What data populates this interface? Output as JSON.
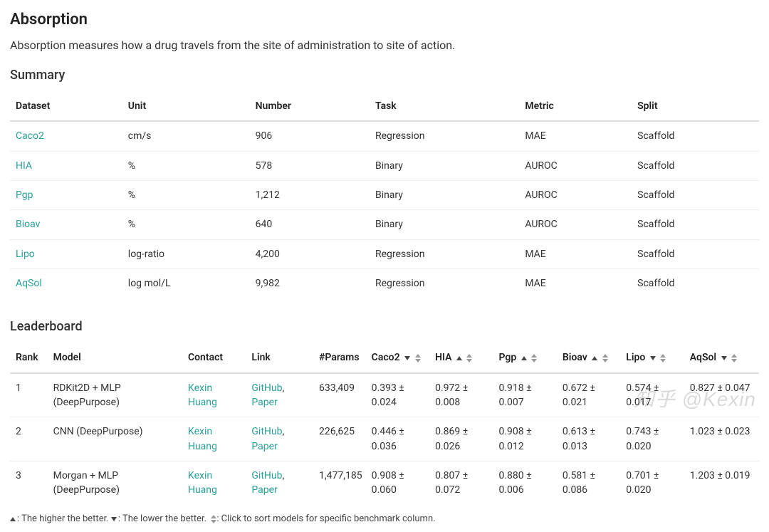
{
  "title": "Absorption",
  "lead": "Absorption measures how a drug travels from the site of administration to site of action.",
  "summary": {
    "heading": "Summary",
    "columns": [
      "Dataset",
      "Unit",
      "Number",
      "Task",
      "Metric",
      "Split"
    ],
    "rows": [
      {
        "dataset": "Caco2",
        "unit": "cm/s",
        "number": "906",
        "task": "Regression",
        "metric": "MAE",
        "split": "Scaffold"
      },
      {
        "dataset": "HIA",
        "unit": "%",
        "number": "578",
        "task": "Binary",
        "metric": "AUROC",
        "split": "Scaffold"
      },
      {
        "dataset": "Pgp",
        "unit": "%",
        "number": "1,212",
        "task": "Binary",
        "metric": "AUROC",
        "split": "Scaffold"
      },
      {
        "dataset": "Bioav",
        "unit": "%",
        "number": "640",
        "task": "Binary",
        "metric": "AUROC",
        "split": "Scaffold"
      },
      {
        "dataset": "Lipo",
        "unit": "log-ratio",
        "number": "4,200",
        "task": "Regression",
        "metric": "MAE",
        "split": "Scaffold"
      },
      {
        "dataset": "AqSol",
        "unit": "log mol/L",
        "number": "9,982",
        "task": "Regression",
        "metric": "MAE",
        "split": "Scaffold"
      }
    ]
  },
  "leaderboard": {
    "heading": "Leaderboard",
    "columns": {
      "rank": "Rank",
      "model": "Model",
      "contact": "Contact",
      "link": "Link",
      "params": "#Params",
      "caco2": "Caco2",
      "hia": "HIA",
      "pgp": "Pgp",
      "bioav": "Bioav",
      "lipo": "Lipo",
      "aqsol": "AqSol"
    },
    "column_dir": {
      "caco2": "down",
      "hia": "up",
      "pgp": "up",
      "bioav": "up",
      "lipo": "down",
      "aqsol": "down"
    },
    "rows": [
      {
        "rank": "1",
        "model": "RDKit2D + MLP (DeepPurpose)",
        "contact": "Kexin Huang",
        "link1": "GitHub",
        "link2": "Paper",
        "link_sep": ", ",
        "params": "633,409",
        "caco2": "0.393 ± 0.024",
        "hia": "0.972 ± 0.008",
        "pgp": "0.918 ± 0.007",
        "bioav": "0.672 ± 0.021",
        "lipo": "0.574 ± 0.017",
        "aqsol": "0.827 ± 0.047"
      },
      {
        "rank": "2",
        "model": "CNN (DeepPurpose)",
        "contact": "Kexin Huang",
        "link1": "GitHub",
        "link2": "Paper",
        "link_sep": ", ",
        "params": "226,625",
        "caco2": "0.446 ± 0.036",
        "hia": "0.869 ± 0.026",
        "pgp": "0.908 ± 0.012",
        "bioav": "0.613 ± 0.013",
        "lipo": "0.743 ± 0.020",
        "aqsol": "1.023 ± 0.023"
      },
      {
        "rank": "3",
        "model": "Morgan + MLP (DeepPurpose)",
        "contact": "Kexin Huang",
        "link1": "GitHub",
        "link2": "Paper",
        "link_sep": ", ",
        "params": "1,477,185",
        "caco2": "0.908 ± 0.060",
        "hia": "0.807 ± 0.072",
        "pgp": "0.880 ± 0.006",
        "bioav": "0.581 ± 0.086",
        "lipo": "0.701 ± 0.020",
        "aqsol": "1.203 ± 0.019"
      }
    ]
  },
  "legend": {
    "higher": ": The higher the better. ",
    "lower": ": The lower the better. ",
    "sort": ": Click to sort models for specific benchmark column."
  },
  "watermark": "知乎 @Kexin"
}
